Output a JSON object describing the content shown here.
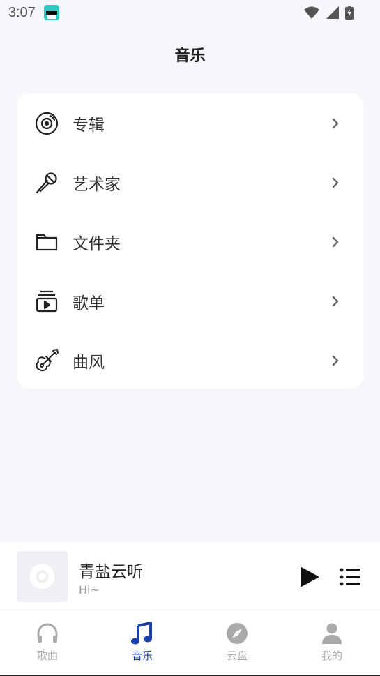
{
  "status_bar": {
    "time": "3:07",
    "icons": [
      "app-notification-icon",
      "wifi-icon",
      "cellular-signal-icon",
      "battery-charging-icon"
    ]
  },
  "header": {
    "title": "音乐"
  },
  "menu": {
    "items": [
      {
        "label": "专辑",
        "icon": "album-disc-icon"
      },
      {
        "label": "艺术家",
        "icon": "microphone-icon"
      },
      {
        "label": "文件夹",
        "icon": "folder-icon"
      },
      {
        "label": "歌单",
        "icon": "playlist-icon"
      },
      {
        "label": "曲风",
        "icon": "guitar-icon"
      }
    ]
  },
  "mini_player": {
    "title": "青盐云听",
    "subtitle": "Hi~",
    "play_icon": "play-icon",
    "queue_icon": "queue-list-icon"
  },
  "tab_bar": {
    "tabs": [
      {
        "label": "歌曲",
        "icon": "headphones-icon",
        "active": false
      },
      {
        "label": "音乐",
        "icon": "music-note-icon",
        "active": true
      },
      {
        "label": "云盘",
        "icon": "compass-icon",
        "active": false
      },
      {
        "label": "我的",
        "icon": "person-icon",
        "active": false
      }
    ]
  },
  "colors": {
    "accent": "#1a3fa8",
    "inactive": "#aaaaaa",
    "background": "#f6f7fa"
  }
}
